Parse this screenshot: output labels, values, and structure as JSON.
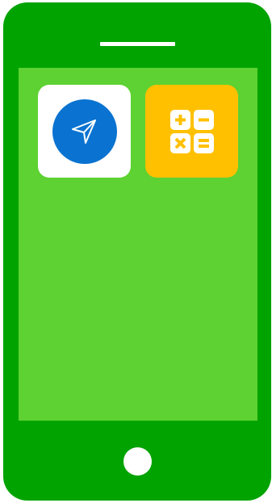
{
  "device": {
    "type": "smartphone",
    "frame_color": "#00a300",
    "screen_color": "#5dd232"
  },
  "home_screen": {
    "apps": [
      {
        "name": "navigation",
        "icon": "navigation-arrow-icon",
        "tile_color": "#ffffff",
        "icon_color": "#0a73d1"
      },
      {
        "name": "calculator",
        "icon": "calculator-icon",
        "tile_color": "#ffc000",
        "icon_color": "#ffffff"
      }
    ]
  },
  "hardware": {
    "speaker": "speaker-slot",
    "home_button": "home-button"
  }
}
